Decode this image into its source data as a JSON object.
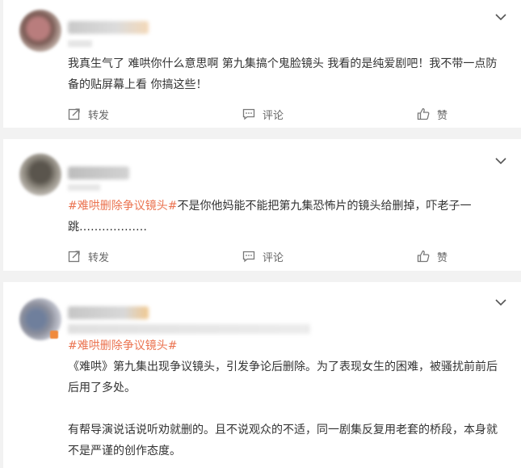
{
  "posts": [
    {
      "text": "我真生气了 难哄你什么意思啊 第九集搞个鬼脸镜头 我看的是纯爱剧吧！我不带一点防备的贴屏幕上看 你搞这些！",
      "actions": {
        "repost": "转发",
        "comment": "评论",
        "like": "赞"
      }
    },
    {
      "hashtag": "#难哄删除争议镜头#",
      "text": "不是你他妈能不能把第九集恐怖片的镜头给删掉，吓老子一跳………………",
      "actions": {
        "repost": "转发",
        "comment": "评论",
        "like": "赞"
      }
    },
    {
      "hashtag": "#难哄删除争议镜头#",
      "paragraph1": "《难哄》第九集出现争议镜头，引发争论后删除。为了表现女生的困难，被骚扰前前后后用了多处。",
      "paragraph2": "有帮导演说话说听劝就删的。且不说观众的不适，同一剧集反复用老套的桥段，本身就不是严谨的创作态度。"
    }
  ],
  "colors": {
    "hashtag": "#eb7350",
    "text": "#333333",
    "muted": "#666666",
    "background": "#f2f2f2"
  },
  "icons": {
    "more": "chevron-down-icon",
    "repost": "repost-icon",
    "comment": "comment-icon",
    "like": "thumbs-up-icon"
  }
}
